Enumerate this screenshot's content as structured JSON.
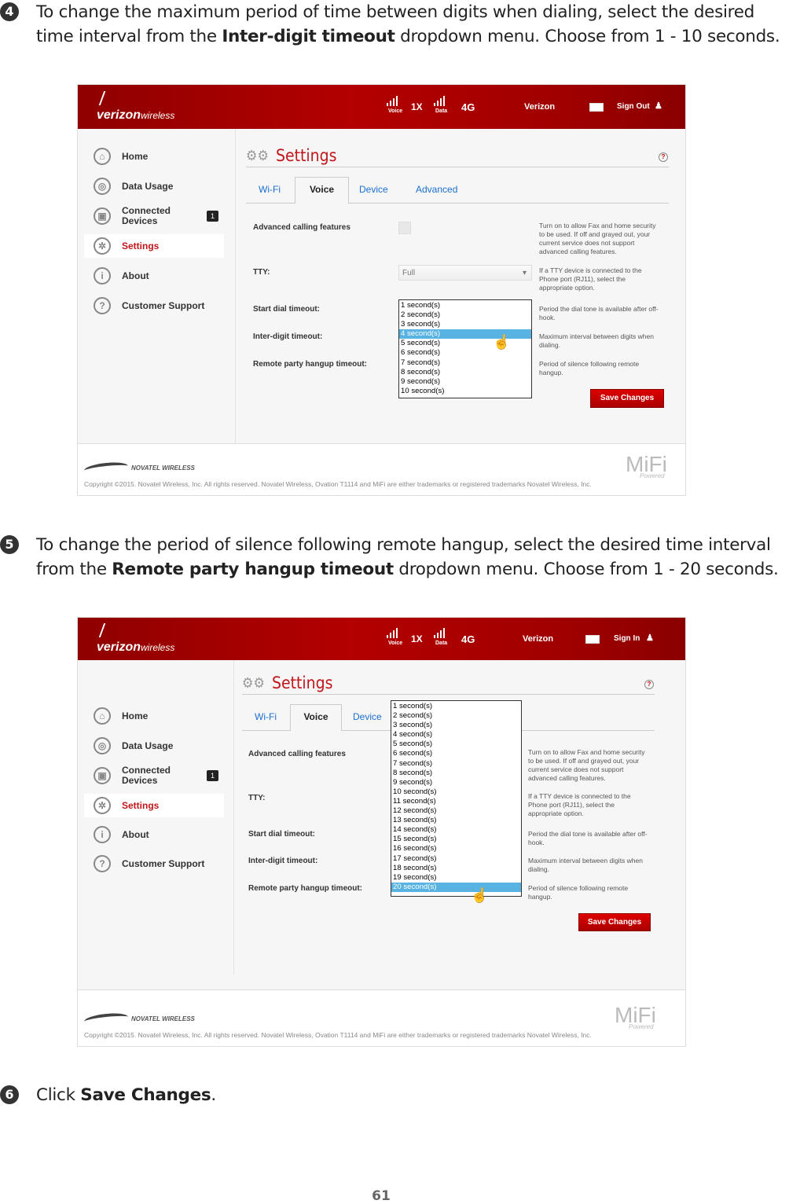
{
  "steps": [
    {
      "num": "4",
      "pre": "To change the maximum period of time between digits when dialing, select the desired time interval from the ",
      "bold": "Inter-digit timeout",
      "post": " dropdown menu. Choose from 1 - 10 seconds."
    },
    {
      "num": "5",
      "pre": "To change the period of silence following remote hangup, select the desired time interval from the ",
      "bold": "Remote party hangup timeout",
      "post": " dropdown menu. Choose from 1 - 20 seconds."
    },
    {
      "num": "6",
      "pre": "Click ",
      "bold": "Save Changes",
      "post": "."
    }
  ],
  "page_number": "61",
  "colors": {
    "header_red": "#a00000",
    "accent_red": "#c0161b",
    "link_blue": "#1a6fd0",
    "selected_option": "#58b3e2"
  },
  "panels": [
    {
      "header": {
        "logo": "verizon",
        "logo_suffix": "wireless",
        "voice": "Voice",
        "tech": "1X",
        "data": "Data",
        "network": "4G",
        "carrier": "Verizon",
        "sign": "Sign Out"
      },
      "sidebar": [
        {
          "label": "Home",
          "icon": "home-icon"
        },
        {
          "label": "Data Usage",
          "icon": "globe-icon"
        },
        {
          "label": "Connected Devices",
          "icon": "devices-icon",
          "badge": "1"
        },
        {
          "label": "Settings",
          "icon": "gear-icon",
          "active": true
        },
        {
          "label": "About",
          "icon": "info-icon"
        },
        {
          "label": "Customer Support",
          "icon": "help-icon"
        }
      ],
      "title": "Settings",
      "tabs": [
        "Wi-Fi",
        "Voice",
        "Device",
        "Advanced"
      ],
      "active_tab": "Voice",
      "rows": [
        {
          "label": "Advanced calling features",
          "help": "Turn on to allow Fax and home security to be used. If off and grayed out, your current service does not support advanced calling features."
        },
        {
          "label": "TTY:",
          "value": "Full",
          "help": "If a TTY device is connected to the Phone port (RJ11), select the appropriate option."
        },
        {
          "label": "Start dial timeout:",
          "help": "Period the dial tone is available after off-hook."
        },
        {
          "label": "Inter-digit timeout:",
          "help": "Maximum interval between digits when dialing."
        },
        {
          "label": "Remote party hangup timeout:",
          "help": "Period of silence following remote hangup."
        }
      ],
      "dropdown": {
        "options": [
          "1 second(s)",
          "2 second(s)",
          "3 second(s)",
          "4 second(s)",
          "5 second(s)",
          "6 second(s)",
          "7 second(s)",
          "8 second(s)",
          "9 second(s)",
          "10 second(s)"
        ],
        "selected": "4 second(s)"
      },
      "save": "Save Changes",
      "footer": {
        "brand": "NOVATEL WIRELESS",
        "copyright": "Copyright ©2015. Novatel Wireless, Inc. All rights reserved. Novatel Wireless, Ovation T1114 and MiFi are either trademarks or registered trademarks Novatel Wireless, Inc.",
        "mifi": "MiFi",
        "powered": "Powered"
      }
    },
    {
      "header": {
        "logo": "verizon",
        "logo_suffix": "wireless",
        "voice": "Voice",
        "tech": "1X",
        "data": "Data",
        "network": "4G",
        "carrier": "Verizon",
        "sign": "Sign In"
      },
      "sidebar": [
        {
          "label": "Home",
          "icon": "home-icon"
        },
        {
          "label": "Data Usage",
          "icon": "globe-icon"
        },
        {
          "label": "Connected Devices",
          "icon": "devices-icon",
          "badge": "1"
        },
        {
          "label": "Settings",
          "icon": "gear-icon",
          "active": true
        },
        {
          "label": "About",
          "icon": "info-icon"
        },
        {
          "label": "Customer Support",
          "icon": "help-icon"
        }
      ],
      "title": "Settings",
      "tabs": [
        "Wi-Fi",
        "Voice",
        "Device"
      ],
      "active_tab": "Voice",
      "rows": [
        {
          "label": "Advanced calling features",
          "help": "Turn on to allow Fax and home security to be used. If off and grayed out, your current service does not support advanced calling features."
        },
        {
          "label": "TTY:",
          "help": "If a TTY device is connected to the Phone port (RJ11), select the appropriate option."
        },
        {
          "label": "Start dial timeout:",
          "help": "Period the dial tone is available after off-hook."
        },
        {
          "label": "Inter-digit timeout:",
          "help": "Maximum interval between digits when dialing."
        },
        {
          "label": "Remote party hangup timeout:",
          "help": "Period of silence following remote hangup."
        }
      ],
      "dropdown": {
        "options": [
          "1 second(s)",
          "2 second(s)",
          "3 second(s)",
          "4 second(s)",
          "5 second(s)",
          "6 second(s)",
          "7 second(s)",
          "8 second(s)",
          "9 second(s)",
          "10 second(s)",
          "11 second(s)",
          "12 second(s)",
          "13 second(s)",
          "14 second(s)",
          "15 second(s)",
          "16 second(s)",
          "17 second(s)",
          "18 second(s)",
          "19 second(s)",
          "20 second(s)"
        ],
        "selected": "20 second(s)"
      },
      "save": "Save Changes",
      "footer": {
        "brand": "NOVATEL WIRELESS",
        "copyright": "Copyright ©2015. Novatel Wireless, Inc. All rights reserved. Novatel Wireless, Ovation T1114 and MiFi are either trademarks or registered trademarks Novatel Wireless, Inc.",
        "mifi": "MiFi",
        "powered": "Powered"
      }
    }
  ]
}
